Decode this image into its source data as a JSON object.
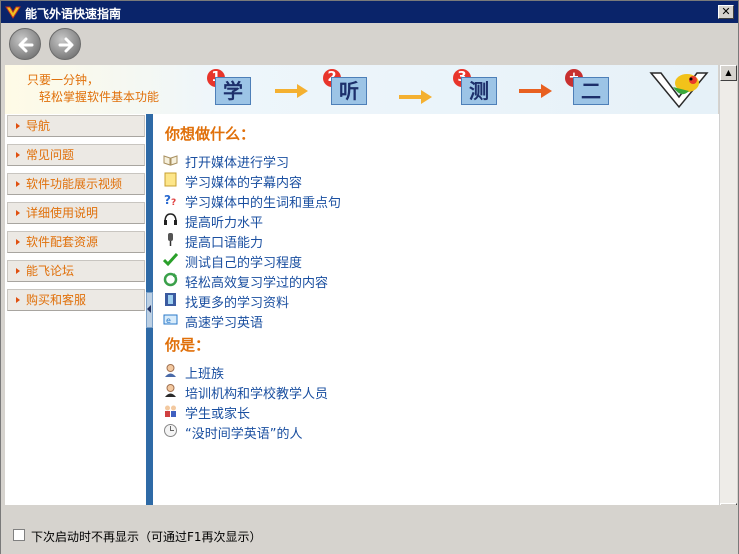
{
  "window": {
    "title": "能飞外语快速指南",
    "close_label": "✕"
  },
  "toolbar": {
    "back_label": "back",
    "forward_label": "forward"
  },
  "banner": {
    "slogan_line1": "只要一分钟，",
    "slogan_line2": "轻松掌握软件基本功能",
    "steps": [
      {
        "num": "1",
        "glyph": "学"
      },
      {
        "num": "2",
        "glyph": "听"
      },
      {
        "num": "3",
        "glyph": "测"
      },
      {
        "num": "+",
        "glyph": "二"
      }
    ]
  },
  "sidebar": {
    "items": [
      {
        "label": "导航"
      },
      {
        "label": "常见问题"
      },
      {
        "label": "软件功能展示视频"
      },
      {
        "label": "详细使用说明"
      },
      {
        "label": "软件配套资源"
      },
      {
        "label": "能飞论坛"
      },
      {
        "label": "购买和客服"
      }
    ]
  },
  "content": {
    "heading_what": "你想做什么：",
    "tasks": [
      {
        "label": "打开媒体进行学习",
        "icon": "open-book-icon"
      },
      {
        "label": "学习媒体的字幕内容",
        "icon": "note-icon"
      },
      {
        "label": "学习媒体中的生词和重点句",
        "icon": "question-icon"
      },
      {
        "label": "提高听力水平",
        "icon": "headphones-icon"
      },
      {
        "label": "提高口语能力",
        "icon": "microphone-icon"
      },
      {
        "label": "测试自己的学习程度",
        "icon": "checkmark-icon"
      },
      {
        "label": "轻松高效复习学过的内容",
        "icon": "refresh-icon"
      },
      {
        "label": "找更多的学习资料",
        "icon": "film-icon"
      },
      {
        "label": "高速学习英语",
        "icon": "speed-icon"
      }
    ],
    "heading_who": "你是：",
    "roles": [
      {
        "label": "上班族",
        "icon": "worker-icon"
      },
      {
        "label": "培训机构和学校教学人员",
        "icon": "teacher-icon"
      },
      {
        "label": "学生或家长",
        "icon": "family-icon"
      },
      {
        "label": "“没时间学英语”的人",
        "icon": "clock-icon"
      }
    ]
  },
  "footer": {
    "checkbox_label": "下次启动时不再显示（可通过F1再次显示）",
    "checked": false
  },
  "colors": {
    "titlebar": "#0a246a",
    "accent_orange": "#e0700a",
    "link_blue": "#1a4fa0",
    "splitter": "#2e6aa6"
  }
}
